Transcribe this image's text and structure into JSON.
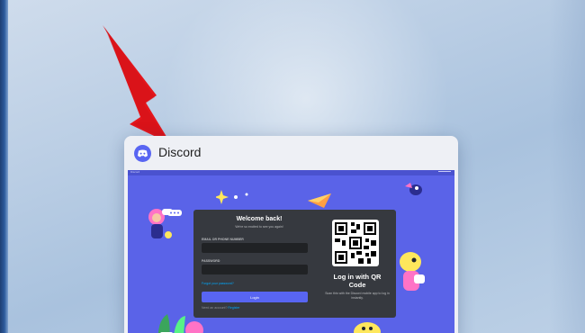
{
  "window": {
    "title": "Discord",
    "icon": "discord-icon"
  },
  "preview": {
    "titlebar_label": "Discord",
    "login": {
      "heading": "Welcome back!",
      "subheading": "We're so excited to see you again!",
      "email_label": "EMAIL OR PHONE NUMBER",
      "password_label": "PASSWORD",
      "forgot_link": "Forgot your password?",
      "login_button": "Login",
      "register_prompt": "Need an account?",
      "register_link": "Register"
    },
    "qr": {
      "heading": "Log in with QR Code",
      "subheading": "Scan this with the Discord mobile app to log in instantly."
    }
  },
  "annotation": {
    "arrow_color": "#e4161c"
  },
  "colors": {
    "discord_blurple": "#5865f2",
    "preview_background": "#5a63e8",
    "card_background": "#36393f"
  }
}
